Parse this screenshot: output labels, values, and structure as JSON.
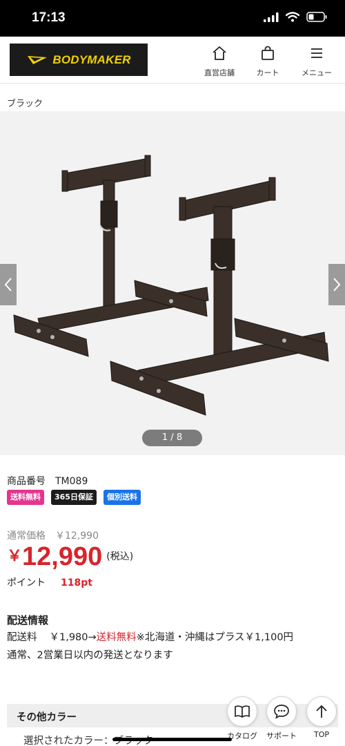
{
  "status_bar": {
    "time": "17:13"
  },
  "header": {
    "logo_text": "BODYMAKER",
    "nav": [
      {
        "label": "直営店舗",
        "icon": "home-icon"
      },
      {
        "label": "カート",
        "icon": "shopping-bag-icon"
      },
      {
        "label": "メニュー",
        "icon": "menu-icon"
      }
    ]
  },
  "product": {
    "color_label": "ブラック",
    "image_counter": "1 / 8",
    "code_label": "商品番号",
    "code": "TM089",
    "badges": [
      {
        "label": "送料無料",
        "color": "#e5358f"
      },
      {
        "label": "365日保証",
        "color": "#1c1c1c"
      },
      {
        "label": "個別送料",
        "color": "#1a73e8"
      }
    ],
    "regular_price_label": "通常価格",
    "regular_price": "￥12,990",
    "sale_currency": "￥",
    "sale_price": "12,990",
    "tax_note": "(税込)",
    "points_label": "ポイント",
    "points_value": "118pt"
  },
  "shipping": {
    "title": "配送情報",
    "fee_label": "配送料",
    "fee_text": "￥1,980→",
    "free_text": "送料無料",
    "note": "※北海道・沖縄はプラス￥1,100円",
    "delivery": "通常、2営業日以内の発送となります"
  },
  "other_colors": {
    "title": "その他カラー",
    "selected": "選択されたカラー：ブラック"
  },
  "floating": [
    {
      "label": "カタログ",
      "icon": "book-icon"
    },
    {
      "label": "サポート",
      "icon": "chat-icon"
    },
    {
      "label": "TOP",
      "icon": "arrow-up-icon"
    }
  ],
  "colors": {
    "accent_red": "#d8242c",
    "logo_yellow": "#f1d100"
  }
}
